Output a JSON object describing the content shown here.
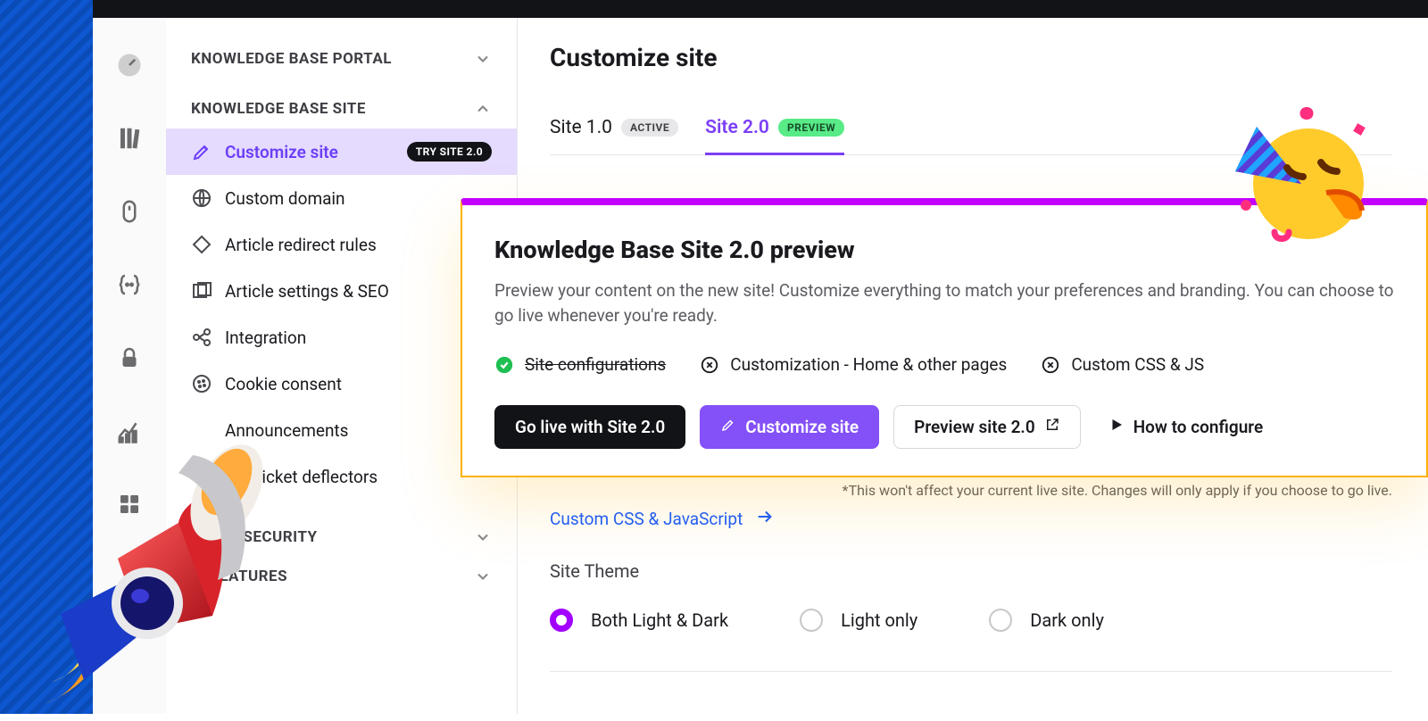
{
  "colors": {
    "accent_purple": "#8450f7",
    "accent_blue": "#1659ff",
    "accent_orange": "#ffb200",
    "accent_magenta": "#c400ff",
    "badge_green": "#58eb87"
  },
  "iconrail": {
    "items": [
      "dashboard-icon",
      "books-icon",
      "mouse-icon",
      "json-icon",
      "lock-icon",
      "analytics-icon",
      "apps-icon"
    ]
  },
  "sidebar": {
    "group1": {
      "label": "KNOWLEDGE BASE PORTAL",
      "expanded": false
    },
    "group2": {
      "label": "KNOWLEDGE BASE SITE",
      "expanded": true,
      "items": [
        {
          "label": "Customize site",
          "badge": "TRY SITE 2.0",
          "icon": "design-icon",
          "active": true
        },
        {
          "label": "Custom domain",
          "icon": "globe-icon"
        },
        {
          "label": "Article redirect rules",
          "icon": "redirect-icon"
        },
        {
          "label": "Article settings & SEO",
          "icon": "seo-icon"
        },
        {
          "label": "Integration",
          "icon": "integration-icon"
        },
        {
          "label": "Cookie consent",
          "icon": "cookie-icon"
        },
        {
          "label": "Announcements",
          "icon": "megaphone-icon"
        },
        {
          "label": "Ticket deflectors",
          "icon": "deflector-icon"
        }
      ]
    },
    "group3": {
      "label": "& SECURITY",
      "expanded": false
    },
    "group4": {
      "label": "AI FEATURES",
      "expanded": false
    }
  },
  "page": {
    "title": "Customize site",
    "tabs": [
      {
        "label": "Site 1.0",
        "badge": "ACTIVE",
        "active": false
      },
      {
        "label": "Site 2.0",
        "badge": "PREVIEW",
        "active": true
      }
    ],
    "custom_css_link": "Custom CSS & JavaScript",
    "note": "*This won't affect your current live site. Changes will only apply if you choose to go live.",
    "theme": {
      "title": "Site Theme",
      "options": [
        {
          "label": "Both Light & Dark",
          "selected": true
        },
        {
          "label": "Light only",
          "selected": false
        },
        {
          "label": "Dark only",
          "selected": false
        }
      ]
    }
  },
  "preview_card": {
    "title": "Knowledge Base Site 2.0 preview",
    "description": "Preview your content on the new site! Customize everything to match your preferences and branding. You can choose to go live whenever you're ready.",
    "steps": [
      {
        "label": "Site configurations",
        "state": "done"
      },
      {
        "label": "Customization - Home & other pages",
        "state": "todo"
      },
      {
        "label": "Custom CSS & JS",
        "state": "todo"
      }
    ],
    "actions": {
      "go_live": "Go live with Site 2.0",
      "customize": "Customize site",
      "preview": "Preview site 2.0",
      "howto": "How to configure"
    }
  }
}
